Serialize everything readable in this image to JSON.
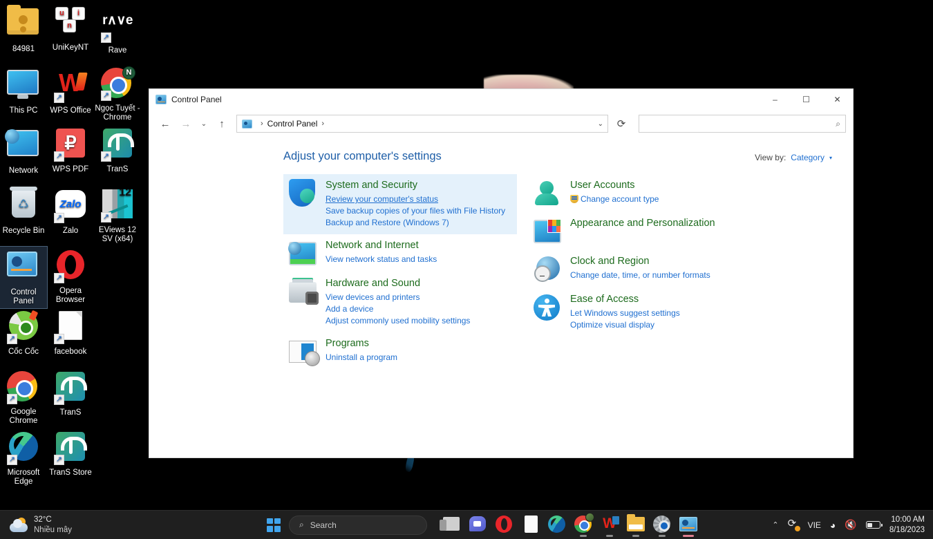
{
  "desktop": {
    "icons": [
      {
        "label": "84981",
        "icon": "folder-icon",
        "shortcut": false
      },
      {
        "label": "UniKeyNT",
        "icon": "unikey-icon",
        "shortcut": false
      },
      {
        "label": "Rave",
        "icon": "rave-icon",
        "shortcut": true
      },
      {
        "label": "This PC",
        "icon": "this-pc-icon",
        "shortcut": false
      },
      {
        "label": "WPS Office",
        "icon": "wps-office-icon",
        "shortcut": true
      },
      {
        "label": "Ngọc Tuyết - Chrome",
        "icon": "chrome-profile-icon",
        "shortcut": true,
        "badge": "N"
      },
      {
        "label": "Network",
        "icon": "network-icon",
        "shortcut": false
      },
      {
        "label": "WPS PDF",
        "icon": "wps-pdf-icon",
        "shortcut": true
      },
      {
        "label": "TranS",
        "icon": "trans-icon",
        "shortcut": true
      },
      {
        "label": "Recycle Bin",
        "icon": "recycle-bin-icon",
        "shortcut": false
      },
      {
        "label": "Zalo",
        "icon": "zalo-icon",
        "shortcut": true
      },
      {
        "label": "EViews 12 SV (x64)",
        "icon": "eviews-icon",
        "shortcut": true
      },
      {
        "label": "Control Panel",
        "icon": "control-panel-icon",
        "shortcut": false,
        "selected": true
      },
      {
        "label": "Opera Browser",
        "icon": "opera-icon",
        "shortcut": true
      },
      {
        "label": "Cốc Cốc",
        "icon": "coccoc-icon",
        "shortcut": true
      },
      {
        "label": "facebook",
        "icon": "file-icon",
        "shortcut": true
      },
      {
        "label": "Google Chrome",
        "icon": "chrome-icon",
        "shortcut": true
      },
      {
        "label": "TranS",
        "icon": "trans-icon",
        "shortcut": true
      },
      {
        "label": "Microsoft Edge",
        "icon": "edge-icon",
        "shortcut": true
      },
      {
        "label": "TranS Store",
        "icon": "trans-icon",
        "shortcut": true
      }
    ]
  },
  "window": {
    "title": "Control Panel",
    "title_icon": "control-panel-icon",
    "controls": {
      "minimize": "–",
      "maximize": "☐",
      "close": "✕"
    },
    "nav": {
      "back": "←",
      "forward": "→",
      "recent": "⌄",
      "up": "↑",
      "refresh": "⟳",
      "dropdown": "⌄"
    },
    "address": {
      "icon": "control-panel-icon",
      "separator": "›",
      "crumb": "Control Panel",
      "trailing_separator": "›"
    },
    "search": {
      "value": "",
      "placeholder": "",
      "icon": "search-icon"
    }
  },
  "content": {
    "heading": "Adjust your computer's settings",
    "view_by": {
      "label": "View by:",
      "value": "Category",
      "caret": "▾"
    },
    "categories_left": [
      {
        "title": "System and Security",
        "icon": "shield-icon",
        "highlighted": true,
        "links": [
          {
            "text": "Review your computer's status",
            "underline": true
          },
          {
            "text": "Save backup copies of your files with File History",
            "underline": false
          },
          {
            "text": "Backup and Restore (Windows 7)",
            "underline": false
          }
        ]
      },
      {
        "title": "Network and Internet",
        "icon": "network-monitor-icon",
        "highlighted": false,
        "links": [
          {
            "text": "View network status and tasks",
            "underline": false
          }
        ]
      },
      {
        "title": "Hardware and Sound",
        "icon": "printer-icon",
        "highlighted": false,
        "links": [
          {
            "text": "View devices and printers",
            "underline": false
          },
          {
            "text": "Add a device",
            "underline": false
          },
          {
            "text": "Adjust commonly used mobility settings",
            "underline": false
          }
        ]
      },
      {
        "title": "Programs",
        "icon": "programs-disc-icon",
        "highlighted": false,
        "links": [
          {
            "text": "Uninstall a program",
            "underline": false
          }
        ]
      }
    ],
    "categories_right": [
      {
        "title": "User Accounts",
        "icon": "user-icon",
        "highlighted": false,
        "links": [
          {
            "text": "Change account type",
            "underline": false,
            "shield": true
          }
        ]
      },
      {
        "title": "Appearance and Personalization",
        "icon": "appearance-icon",
        "highlighted": false,
        "links": []
      },
      {
        "title": "Clock and Region",
        "icon": "clock-globe-icon",
        "highlighted": false,
        "links": [
          {
            "text": "Change date, time, or number formats",
            "underline": false
          }
        ]
      },
      {
        "title": "Ease of Access",
        "icon": "accessibility-icon",
        "highlighted": false,
        "links": [
          {
            "text": "Let Windows suggest settings",
            "underline": false
          },
          {
            "text": "Optimize visual display",
            "underline": false
          }
        ]
      }
    ]
  },
  "taskbar": {
    "weather": {
      "temperature": "32°C",
      "condition": "Nhiều mây",
      "icon": "sun-behind-cloud-icon"
    },
    "start": {
      "label": "Start",
      "icon": "windows-logo-icon"
    },
    "search": {
      "placeholder": "Search",
      "icon": "search-icon"
    },
    "apps": [
      {
        "name": "task-view",
        "icon": "task-view-icon",
        "running": false,
        "active": false
      },
      {
        "name": "chat",
        "icon": "chat-icon",
        "running": false,
        "active": false
      },
      {
        "name": "opera",
        "icon": "opera-icon",
        "running": false,
        "active": false
      },
      {
        "name": "file",
        "icon": "file-icon",
        "running": false,
        "active": false
      },
      {
        "name": "edge",
        "icon": "edge-icon",
        "running": false,
        "active": false
      },
      {
        "name": "chrome",
        "icon": "chrome-icon",
        "running": true,
        "active": false
      },
      {
        "name": "wps-office",
        "icon": "wps-office-icon",
        "running": true,
        "active": false
      },
      {
        "name": "file-explorer",
        "icon": "folder-icon",
        "running": true,
        "active": false
      },
      {
        "name": "settings",
        "icon": "gear-icon",
        "running": true,
        "active": false
      },
      {
        "name": "control-panel",
        "icon": "control-panel-icon",
        "running": true,
        "active": true
      }
    ],
    "tray": {
      "overflow_caret": "⌃",
      "sync_icon": "sync-icon",
      "language": "VIE",
      "wifi_icon": "wifi-icon",
      "volume_icon": "volume-muted-icon",
      "battery_icon": "battery-icon",
      "time": "10:00 AM",
      "date": "8/18/2023"
    }
  }
}
